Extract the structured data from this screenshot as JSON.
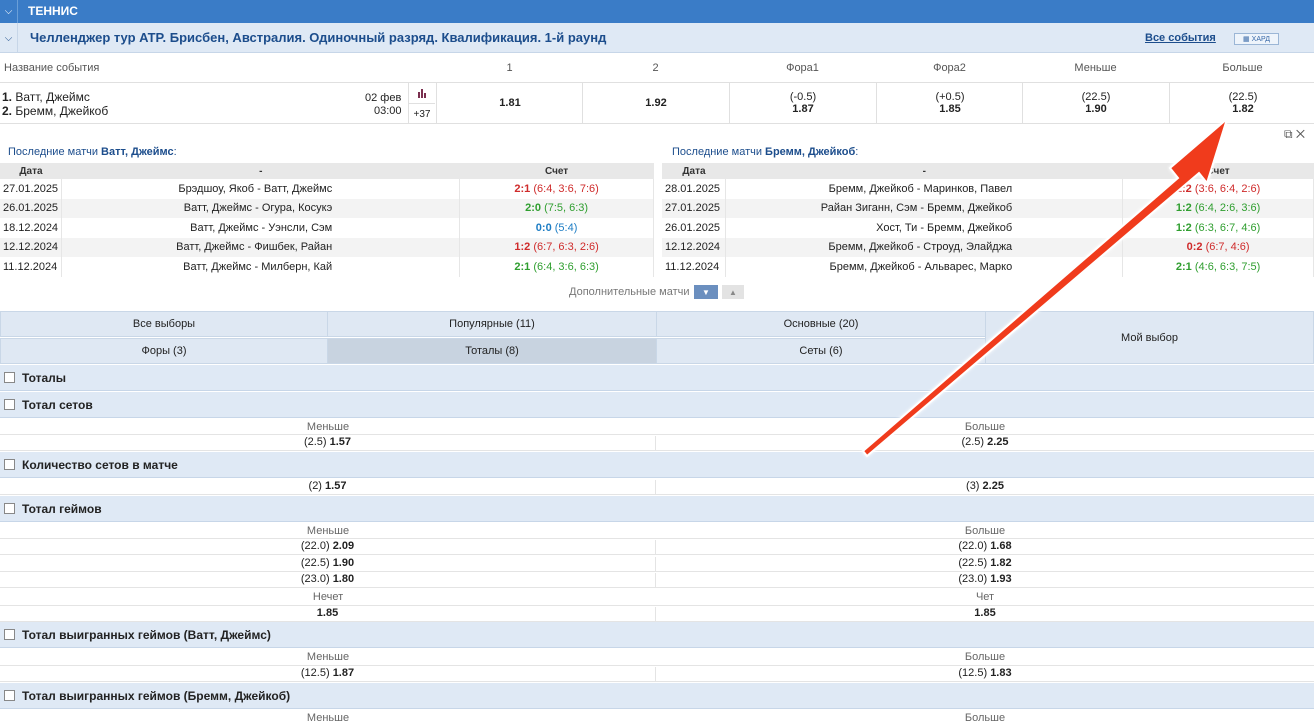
{
  "header": {
    "sport": "ТЕННИС",
    "league": "Челленджер тур ATP. Брисбен, Австралия. Одиночный разряд. Квалификация. 1-й раунд",
    "all_events": "Все события",
    "surface": "ХАРД"
  },
  "columns": {
    "event_name": "Название события",
    "c1": "1",
    "c2": "2",
    "fora1": "Фора1",
    "fora2": "Фора2",
    "less": "Меньше",
    "more": "Больше"
  },
  "event": {
    "p1_num": "1.",
    "p1": "Ватт, Джеймс",
    "p2_num": "2.",
    "p2": "Бремм, Джейкоб",
    "date": "02 фев",
    "time": "03:00",
    "more_count": "+37",
    "odd1": "1.81",
    "odd2": "1.92",
    "fora1_line": "(-0.5)",
    "fora1_odd": "1.87",
    "fora2_line": "(+0.5)",
    "fora2_odd": "1.85",
    "less_line": "(22.5)",
    "less_odd": "1.90",
    "more_line": "(22.5)",
    "more_odd": "1.82"
  },
  "last_matches": {
    "left_prefix": "Последние матчи ",
    "left_player": "Ватт, Джеймс",
    "right_prefix": "Последние матчи ",
    "right_player": "Бремм, Джейкоб",
    "suffix": ":",
    "col_date": "Дата",
    "col_match": "-",
    "col_score": "Счет",
    "left": [
      {
        "date": "27.01.2025",
        "match": "Брэдшоу, Якоб - Ватт, Джеймс",
        "score": "2:1",
        "sets": "(6:4, 3:6, 7:6)",
        "result": "l"
      },
      {
        "date": "26.01.2025",
        "match": "Ватт, Джеймс - Огура, Косукэ",
        "score": "2:0",
        "sets": "(7:5, 6:3)",
        "result": "w"
      },
      {
        "date": "18.12.2024",
        "match": "Ватт, Джеймс - Уэнсли, Сэм",
        "score": "0:0",
        "sets": "(5:4)",
        "result": "dr"
      },
      {
        "date": "12.12.2024",
        "match": "Ватт, Джеймс - Фишбек, Райан",
        "score": "1:2",
        "sets": "(6:7, 6:3, 2:6)",
        "result": "l"
      },
      {
        "date": "11.12.2024",
        "match": "Ватт, Джеймс - Милберн, Кай",
        "score": "2:1",
        "sets": "(6:4, 3:6, 6:3)",
        "result": "w"
      }
    ],
    "right": [
      {
        "date": "28.01.2025",
        "match": "Бремм, Джейкоб - Маринков, Павел",
        "score": "1:2",
        "sets": "(3:6, 6:4, 2:6)",
        "result": "l"
      },
      {
        "date": "27.01.2025",
        "match": "Райан Зиганн, Сэм - Бремм, Джейкоб",
        "score": "1:2",
        "sets": "(6:4, 2:6, 3:6)",
        "result": "w"
      },
      {
        "date": "26.01.2025",
        "match": "Хост, Ти - Бремм, Джейкоб",
        "score": "1:2",
        "sets": "(6:3, 6:7, 4:6)",
        "result": "w"
      },
      {
        "date": "12.12.2024",
        "match": "Бремм, Джейкоб - Строуд, Элайджа",
        "score": "0:2",
        "sets": "(6:7, 4:6)",
        "result": "l"
      },
      {
        "date": "11.12.2024",
        "match": "Бремм, Джейкоб - Альварес, Марко",
        "score": "2:1",
        "sets": "(4:6, 6:3, 7:5)",
        "result": "w"
      }
    ],
    "more_label": "Дополнительные матчи"
  },
  "tabs": {
    "all": "Все выборы",
    "popular": "Популярные (11)",
    "main": "Основные (20)",
    "my": "Мой выбор",
    "foras": "Форы (3)",
    "totals": "Тоталы (8)",
    "sets": "Сеты (6)"
  },
  "markets": {
    "totals_title": "Тоталы",
    "total_sets": {
      "title": "Тотал сетов",
      "less": "Меньше",
      "more": "Больше",
      "l_line": "(2.5)",
      "l_odd": "1.57",
      "r_line": "(2.5)",
      "r_odd": "2.25"
    },
    "sets_count": {
      "title": "Количество сетов в матче",
      "l_line": "(2)",
      "l_odd": "1.57",
      "r_line": "(3)",
      "r_odd": "2.25"
    },
    "total_games": {
      "title": "Тотал геймов",
      "less": "Меньше",
      "more": "Больше",
      "rows": [
        {
          "l_line": "(22.0)",
          "l_odd": "2.09",
          "r_line": "(22.0)",
          "r_odd": "1.68"
        },
        {
          "l_line": "(22.5)",
          "l_odd": "1.90",
          "r_line": "(22.5)",
          "r_odd": "1.82"
        },
        {
          "l_line": "(23.0)",
          "l_odd": "1.80",
          "r_line": "(23.0)",
          "r_odd": "1.93"
        }
      ],
      "odd_label": "Нечет",
      "even_label": "Чет",
      "odd_val": "1.85",
      "even_val": "1.85"
    },
    "won_p1": {
      "title": "Тотал выигранных геймов (Ватт, Джеймс)",
      "less": "Меньше",
      "more": "Больше",
      "l_line": "(12.5)",
      "l_odd": "1.87",
      "r_line": "(12.5)",
      "r_odd": "1.83"
    },
    "won_p2": {
      "title": "Тотал выигранных геймов (Бремм, Джейкоб)",
      "less": "Меньше",
      "more": "Больше"
    }
  }
}
